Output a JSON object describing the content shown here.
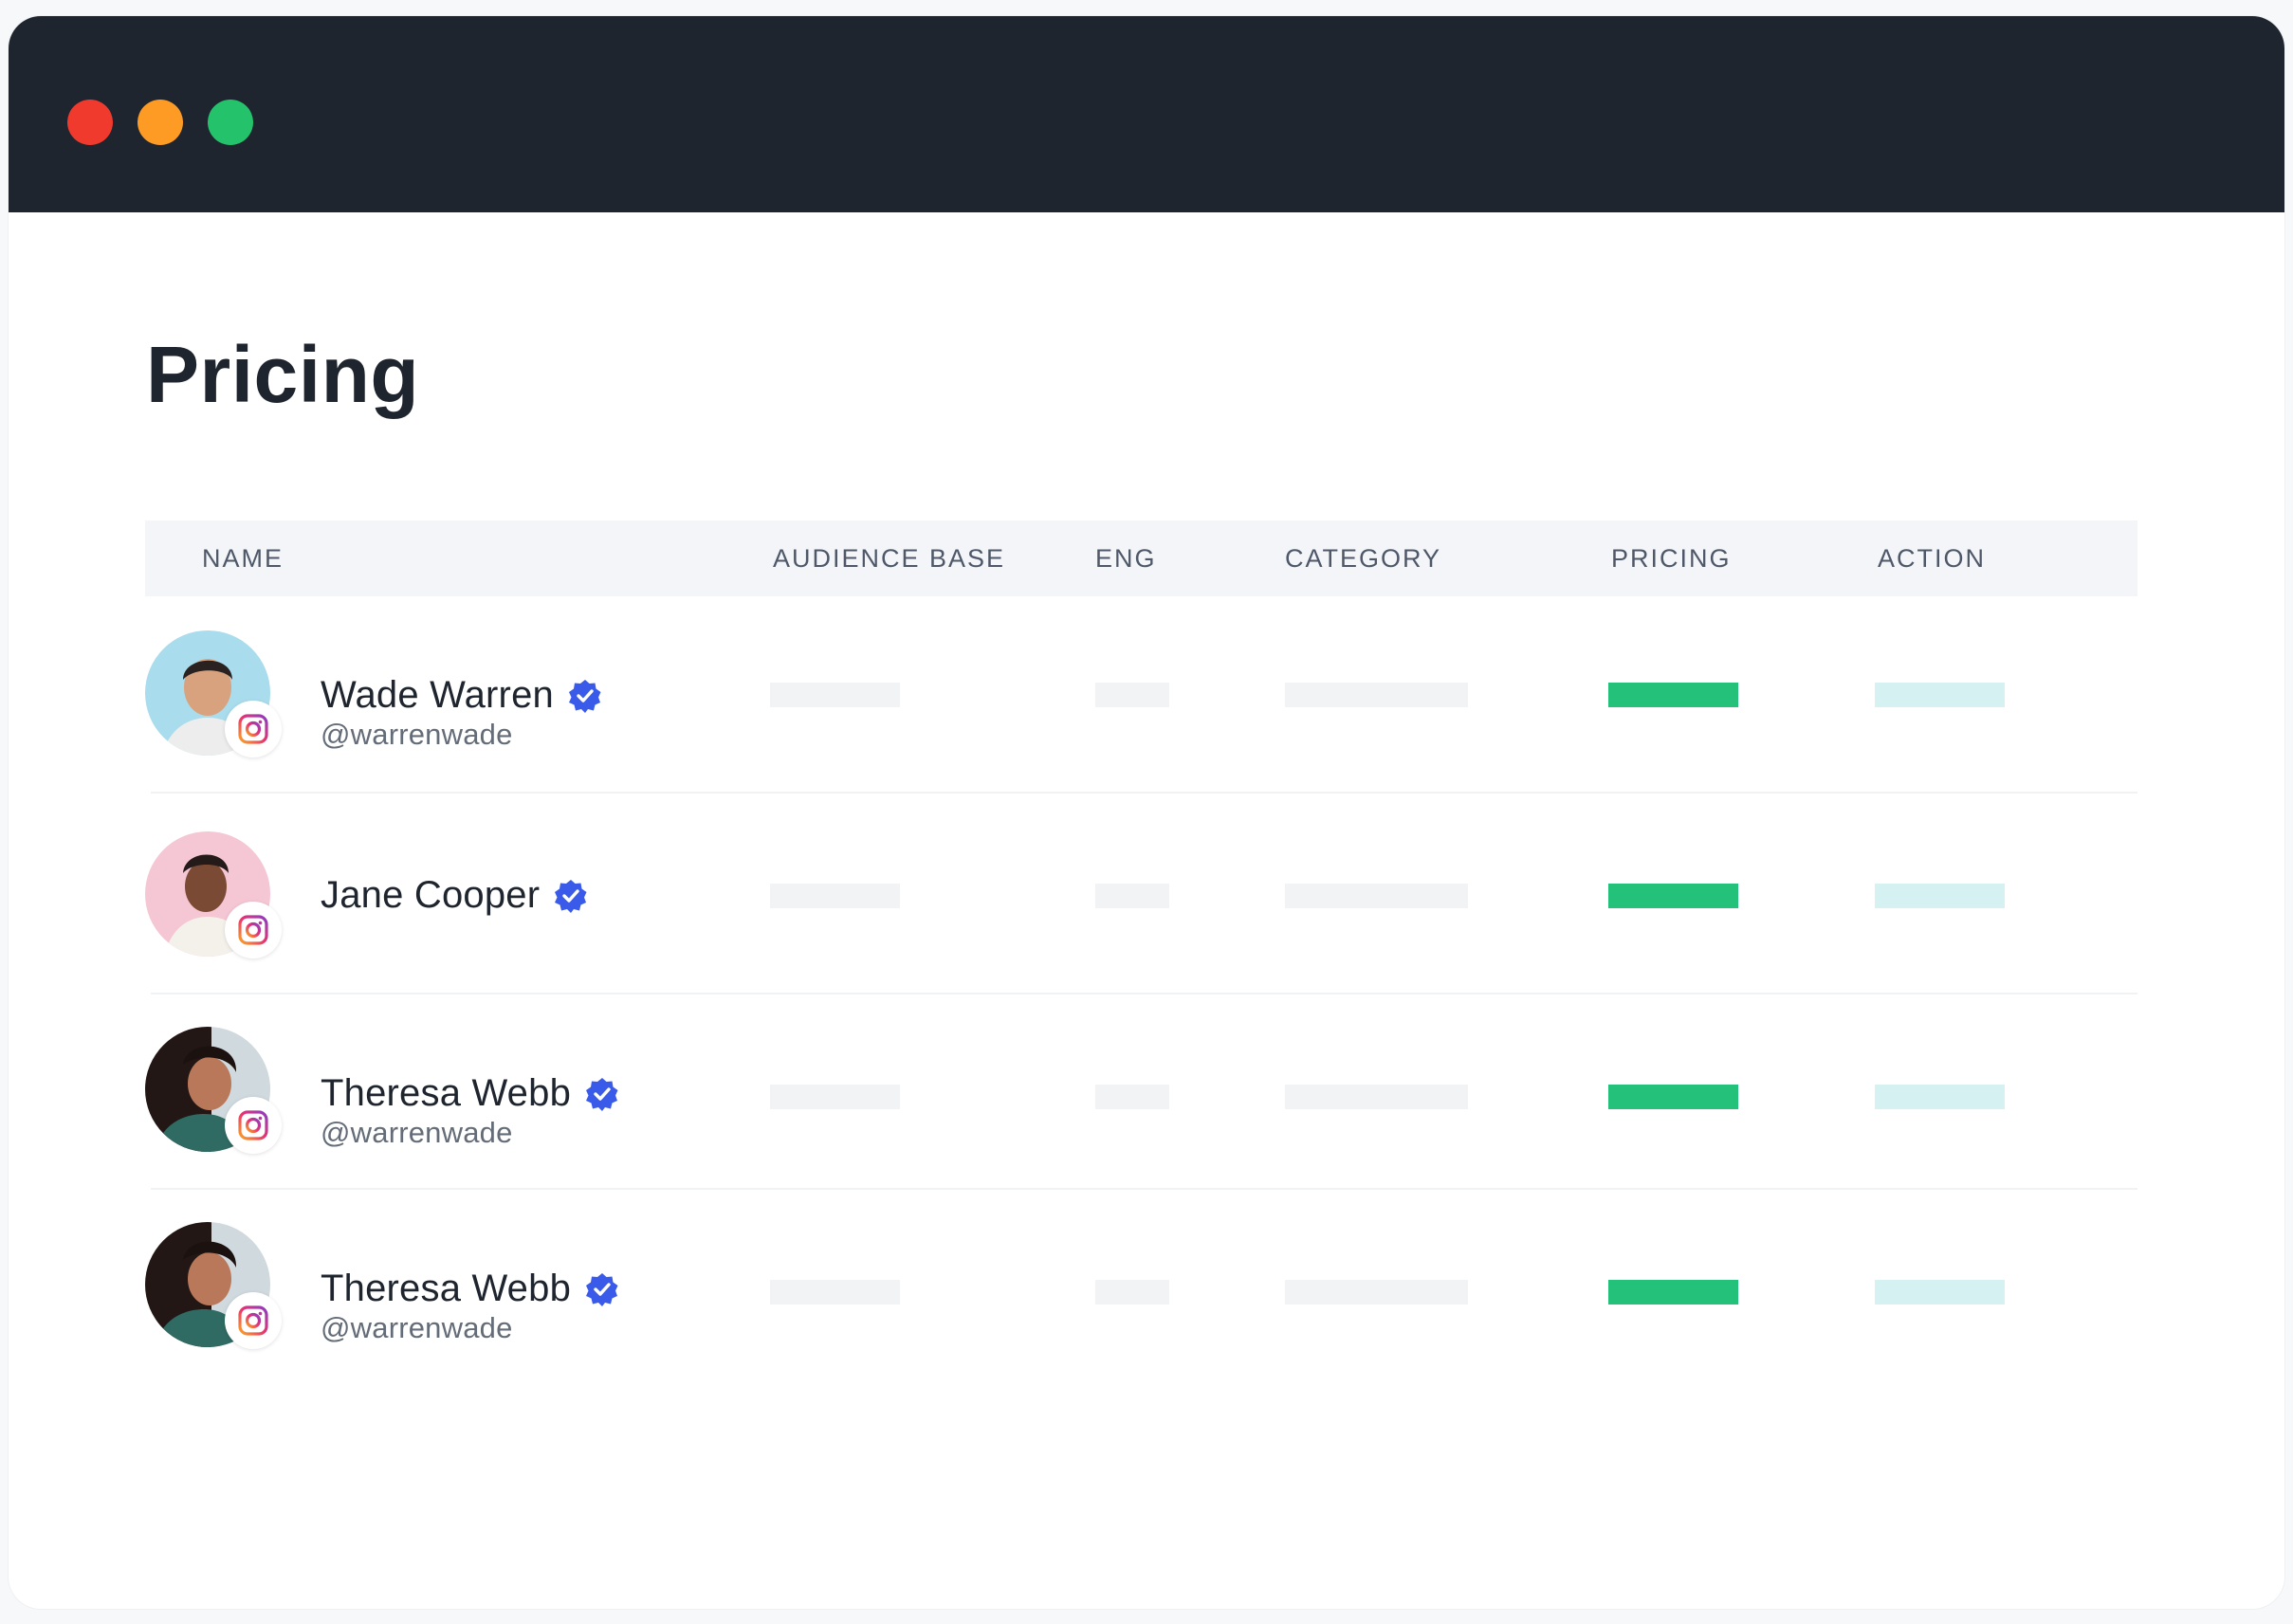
{
  "window": {
    "controls": [
      "close",
      "minimize",
      "maximize"
    ],
    "colors": {
      "titlebar": "#1f252e",
      "close": "#f03a2e",
      "minimize": "#fd9b25",
      "maximize": "#24c26b"
    }
  },
  "page": {
    "title": "Pricing"
  },
  "table": {
    "columns": [
      "NAME",
      "AUDIENCE BASE",
      "ENG",
      "CATEGORY",
      "PRICING",
      "ACTION"
    ],
    "rows": [
      {
        "name": "Wade Warren",
        "handle": "@warrenwade",
        "verified": true,
        "platform": "instagram-icon"
      },
      {
        "name": "Jane Cooper",
        "handle": "",
        "verified": true,
        "platform": "instagram-icon"
      },
      {
        "name": "Theresa Webb",
        "handle": "@warrenwade",
        "verified": true,
        "platform": "instagram-icon"
      },
      {
        "name": "Theresa Webb",
        "handle": "@warrenwade",
        "verified": true,
        "platform": "instagram-icon"
      }
    ]
  },
  "colors": {
    "pricing_bar": "#23c17a",
    "action_bar": "#d6f1f2",
    "placeholder_bar": "#f2f3f5",
    "verified_badge": "#3a5bea"
  }
}
